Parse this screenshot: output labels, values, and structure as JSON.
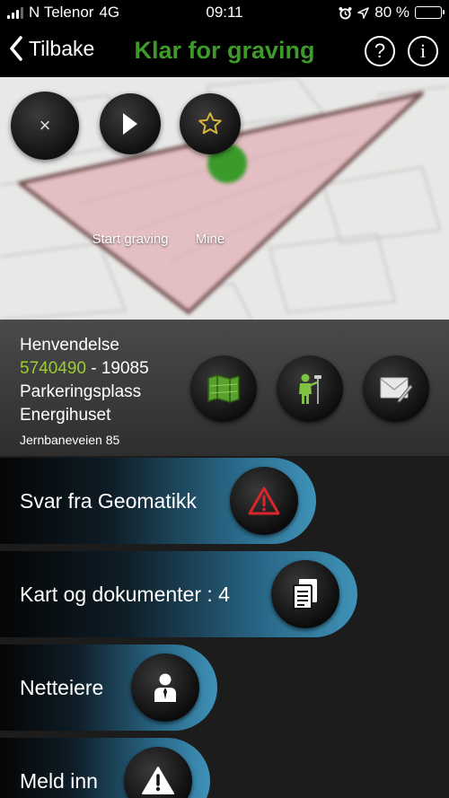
{
  "status_bar": {
    "carrier": "N Telenor",
    "network": "4G",
    "time": "09:11",
    "battery": "80 %",
    "battery_level": 0.8
  },
  "nav": {
    "back_label": "Tilbake",
    "title": "Klar for graving",
    "help_label": "?",
    "info_label": "i",
    "title_color": "#3d9a2b"
  },
  "map_controls": {
    "close_label": "×",
    "start_label": "Start graving",
    "mine_label": "Mine"
  },
  "inquiry": {
    "heading": "Henvendelse",
    "number": "5740490",
    "separator": " - ",
    "sub_number": "19085",
    "place_line1": "Parkeringsplass",
    "place_line2": "Energihuset",
    "address": "Jernbaneveien 85",
    "number_color": "#9acd32"
  },
  "action_icons": [
    "map-icon",
    "surveyor-icon",
    "mail-edit-icon"
  ],
  "menu": {
    "items": [
      {
        "label": "Svar fra Geomatikk",
        "icon": "warning-triangle-icon"
      },
      {
        "label": "Kart og dokumenter : 4",
        "icon": "documents-icon"
      },
      {
        "label": "Netteiere",
        "icon": "person-icon"
      },
      {
        "label": "Meld inn",
        "icon": "alert-icon"
      }
    ]
  }
}
